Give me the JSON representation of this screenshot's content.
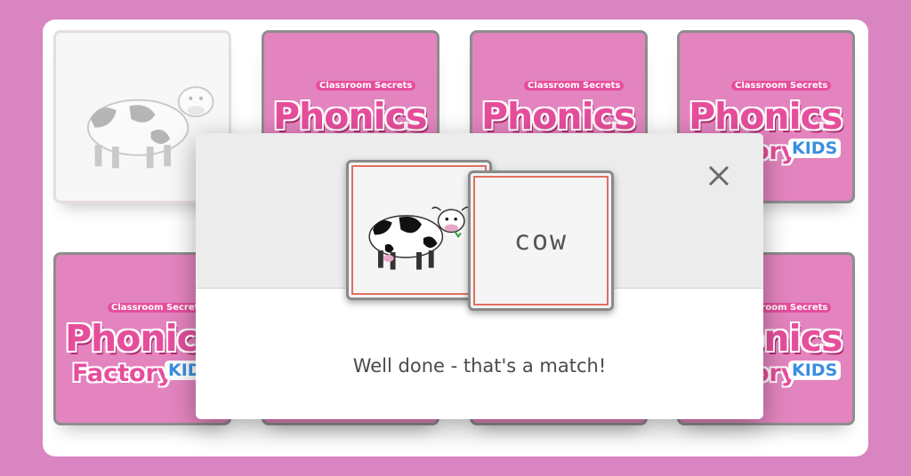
{
  "game": {
    "logo": {
      "brand": "Classroom Secrets",
      "title": "Phonics",
      "subtitle": "Factory",
      "badge": "KIDS"
    },
    "cards": [
      {
        "state": "matched",
        "content": "cow-picture"
      },
      {
        "state": "face-down"
      },
      {
        "state": "face-down"
      },
      {
        "state": "face-down"
      },
      {
        "state": "face-down"
      },
      {
        "state": "face-down"
      },
      {
        "state": "face-down"
      },
      {
        "state": "face-down"
      }
    ]
  },
  "modal": {
    "word": "cow",
    "message": "Well done - that's a match!",
    "close_icon": "close-icon"
  },
  "colors": {
    "background": "#d985c2",
    "card_back": "#e384bf",
    "logo_pink": "#e64e9c",
    "match_border": "#e06f5e"
  }
}
